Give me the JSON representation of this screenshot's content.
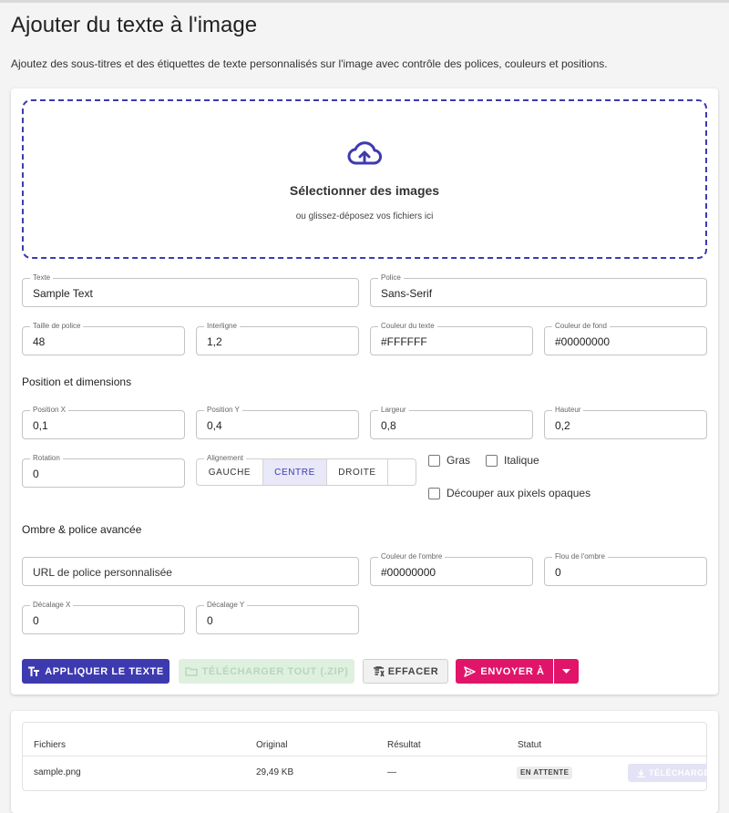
{
  "header": {
    "title": "Ajouter du texte à l'image",
    "subtitle": "Ajoutez des sous-titres et des étiquettes de texte personnalisés sur l'image avec contrôle des polices, couleurs et positions."
  },
  "dropzone": {
    "icon": "cloud-upload-icon",
    "title": "Sélectionner des images",
    "subtitle": "ou glissez-déposez vos fichiers ici"
  },
  "fields": {
    "text": {
      "label": "Texte",
      "value": "Sample Text"
    },
    "font": {
      "label": "Police",
      "value": "Sans-Serif"
    },
    "font_size": {
      "label": "Taille de police",
      "value": "48"
    },
    "line_height": {
      "label": "Interligne",
      "value": "1,2"
    },
    "text_color": {
      "label": "Couleur du texte",
      "value": "#FFFFFF"
    },
    "bg_color": {
      "label": "Couleur de fond",
      "value": "#00000000"
    },
    "pos_x": {
      "label": "Position X",
      "value": "0,1"
    },
    "pos_y": {
      "label": "Position Y",
      "value": "0,4"
    },
    "width": {
      "label": "Largeur",
      "value": "0,8"
    },
    "height": {
      "label": "Hauteur",
      "value": "0,2"
    },
    "rotation": {
      "label": "Rotation",
      "value": "0"
    },
    "custom_font_url": {
      "placeholder": "URL de police personnalisée"
    },
    "shadow_color": {
      "label": "Couleur de l'ombre",
      "value": "#00000000"
    },
    "shadow_blur": {
      "label": "Flou de l'ombre",
      "value": "0"
    },
    "offset_x": {
      "label": "Décalage X",
      "value": "0"
    },
    "offset_y": {
      "label": "Décalage Y",
      "value": "0"
    }
  },
  "sections": {
    "position": "Position et dimensions",
    "shadow": "Ombre & police avancée"
  },
  "alignment": {
    "label": "Alignement",
    "options": [
      "GAUCHE",
      "CENTRE",
      "DROITE"
    ],
    "selected": "CENTRE"
  },
  "checkboxes": {
    "bold": "Gras",
    "italic": "Italique",
    "crop": "Découper aux pixels opaques"
  },
  "buttons": {
    "apply": "APPLIQUER LE TEXTE",
    "download_all": "TÉLÉCHARGER TOUT (.ZIP)",
    "clear": "EFFACER",
    "send": "ENVOYER À"
  },
  "table": {
    "headers": [
      "Fichiers",
      "Original",
      "Résultat",
      "Statut"
    ],
    "rows": [
      {
        "file": "sample.png",
        "original": "29,49 KB",
        "result": "—",
        "status": "EN ATTENTE",
        "action": "TÉLÉCHARGER"
      }
    ]
  },
  "colors": {
    "primary": "#3d3ab0",
    "send": "#e0156a",
    "download_disabled": "#dff0e0"
  }
}
